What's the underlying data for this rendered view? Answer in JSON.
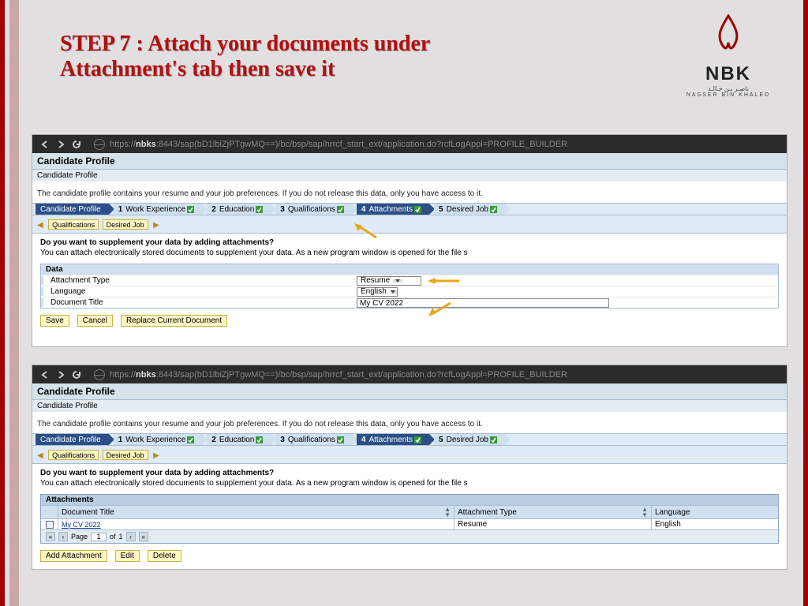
{
  "slide_title": "STEP 7 : Attach your documents under Attachment's tab then save it",
  "logo": {
    "text": "NBK",
    "subAr": "ناصـر بـن خـالـد",
    "subEn": "NASSER BIN KHALED"
  },
  "url_pre": "https://",
  "url_host": "nbks",
  "url_post": ":8443/sap(bD1lbiZjPTgwMQ==)/bc/bsp/sap/hrrcf_start_ext/application.do?rcfLogAppl=PROFILE_BUILDER",
  "app_title": "Candidate Profile",
  "breadcrumb": "Candidate Profile",
  "intro": "The candidate profile contains your resume and your job preferences. If you do not release this data, only you have access to it.",
  "wizard": {
    "home": "Candidate Profile",
    "steps": [
      {
        "n": "1",
        "t": "Work Experience"
      },
      {
        "n": "2",
        "t": "Education"
      },
      {
        "n": "3",
        "t": "Qualifications"
      },
      {
        "n": "4",
        "t": "Attachments"
      },
      {
        "n": "5",
        "t": "Desired Job"
      }
    ]
  },
  "subnav": {
    "a": "Qualifications",
    "b": "Desired Job"
  },
  "q_head": "Do you want to supplement your data by adding attachments?",
  "q_text": "You can attach electronically stored documents to supplement your data. As a new program window is opened for the file s",
  "data_hdr": "Data",
  "form": {
    "atype_label": "Attachment Type",
    "atype_value": "Resume",
    "lang_label": "Language",
    "lang_value": "English",
    "title_label": "Document Title",
    "title_value": "My CV 2022"
  },
  "buttons": {
    "save": "Save",
    "cancel": "Cancel",
    "replace": "Replace Current Document",
    "add": "Add Attachment",
    "edit": "Edit",
    "delete": "Delete"
  },
  "att": {
    "hdr": "Attachments",
    "cols": {
      "title": "Document Title",
      "type": "Attachment Type",
      "lang": "Language"
    },
    "row": {
      "title": "My CV 2022",
      "type": "Resume",
      "lang": "English"
    }
  },
  "pager": {
    "label": "Page",
    "of": "of",
    "total": "1",
    "current": "1"
  }
}
